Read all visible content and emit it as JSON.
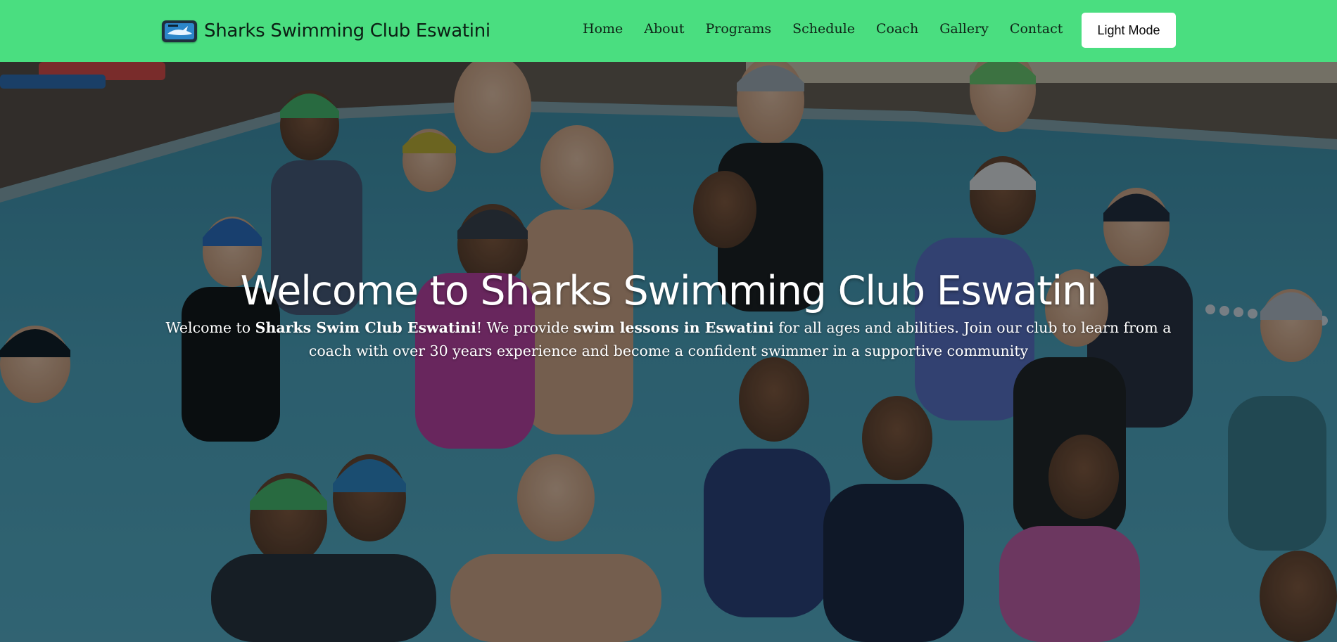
{
  "brand": {
    "name": "Sharks Swimming Club Eswatini",
    "logo_icon": "shark-logo-icon"
  },
  "nav": {
    "items": [
      "Home",
      "About",
      "Programs",
      "Schedule",
      "Coach",
      "Gallery",
      "Contact"
    ]
  },
  "mode_button": {
    "label": "Light Mode"
  },
  "hero": {
    "title": "Welcome to Sharks Swimming Club Eswatini",
    "text_1": "Welcome to ",
    "text_2": "Sharks Swim Club Eswatini",
    "text_3": "! We provide ",
    "text_4": "swim lessons in Eswatini",
    "text_5": " for all ages and abilities. Join our club to learn from a coach with over 30 years experience and become a confident swimmer in a supportive community",
    "image_subject": "group of young swimmers in a pool"
  },
  "colors": {
    "navbar": "#4ade80",
    "pool_water": "#4fa3bd",
    "text_on_hero": "#ffffff"
  }
}
